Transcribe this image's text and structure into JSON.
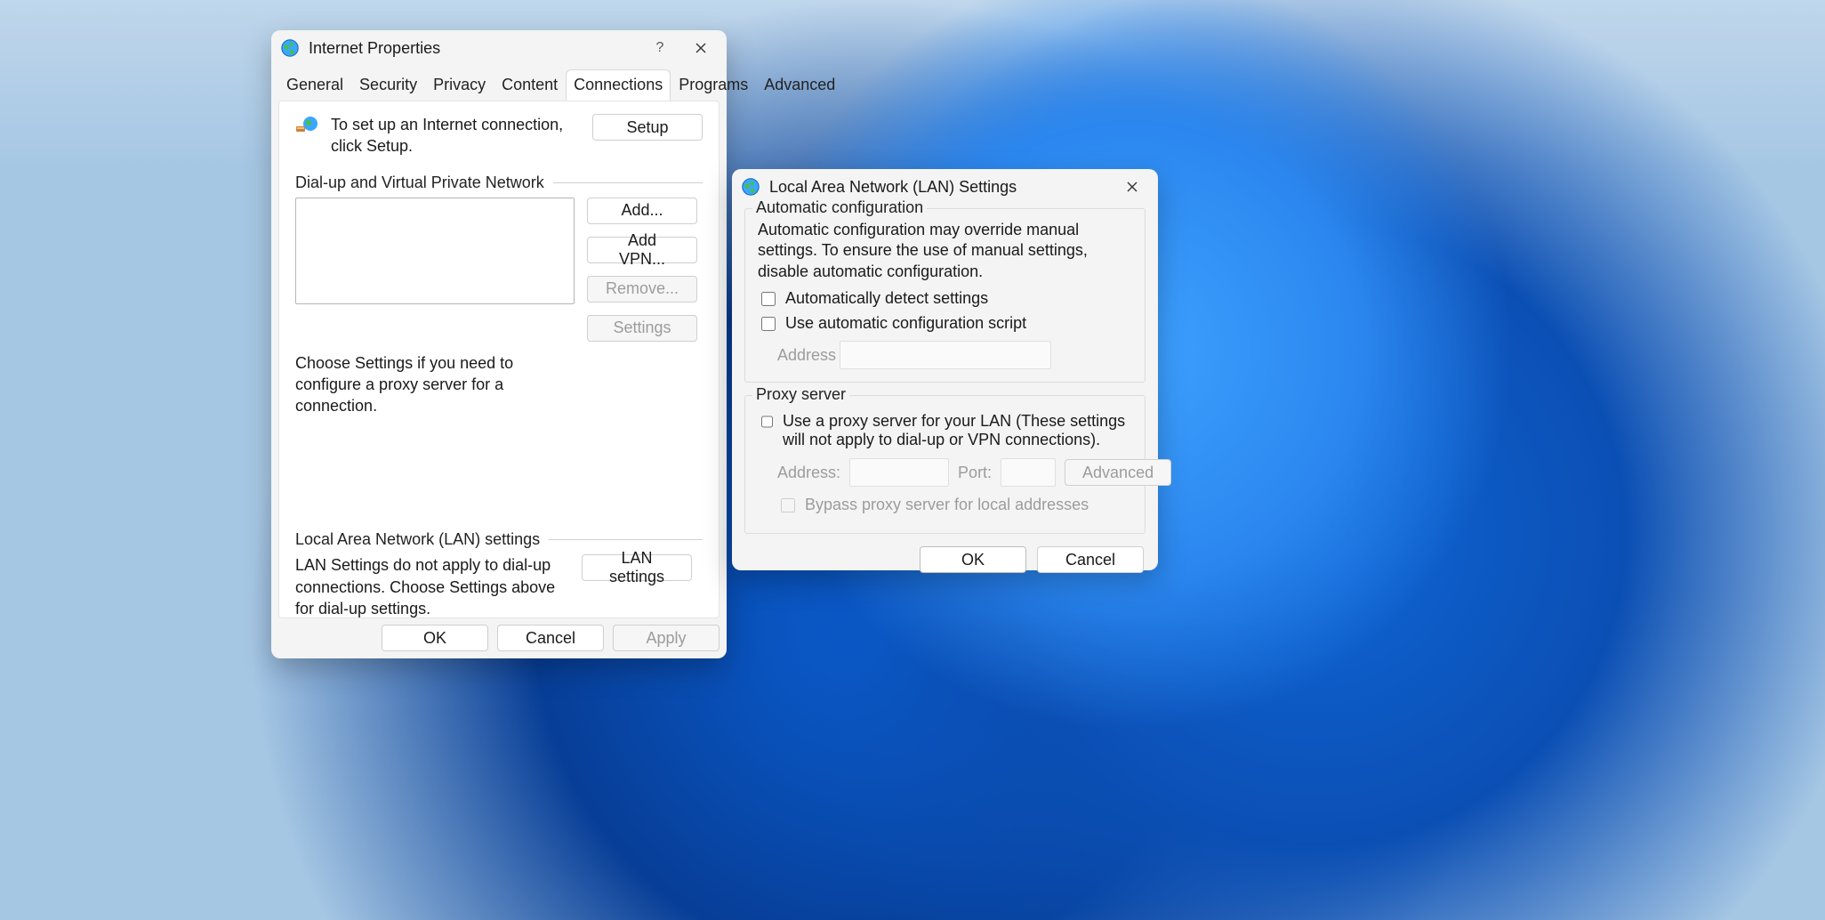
{
  "internet_properties": {
    "title": "Internet Properties",
    "help_tooltip": "?",
    "tabs": {
      "general": "General",
      "security": "Security",
      "privacy": "Privacy",
      "content": "Content",
      "connections": "Connections",
      "programs": "Programs",
      "advanced": "Advanced"
    },
    "active_tab": "connections",
    "setup_text": "To set up an Internet connection, click Setup.",
    "setup_button": "Setup",
    "dialup_group": "Dial-up and Virtual Private Network",
    "add_button": "Add...",
    "add_vpn_button": "Add VPN...",
    "remove_button": "Remove...",
    "settings_button": "Settings",
    "choose_text": "Choose Settings if you need to configure a proxy server for a connection.",
    "lan_group": "Local Area Network (LAN) settings",
    "lan_text": "LAN Settings do not apply to dial-up connections. Choose Settings above for dial-up settings.",
    "lan_settings_button": "LAN settings",
    "ok": "OK",
    "cancel": "Cancel",
    "apply": "Apply"
  },
  "lan_settings": {
    "title": "Local Area Network (LAN) Settings",
    "auto_legend": "Automatic configuration",
    "auto_note": "Automatic configuration may override manual settings.  To ensure the use of manual settings, disable automatic configuration.",
    "auto_detect": "Automatically detect settings",
    "use_script": "Use automatic configuration script",
    "address_label": "Address",
    "proxy_legend": "Proxy server",
    "proxy_note": "Use a proxy server for your LAN (These settings will not apply to dial-up or VPN connections).",
    "addr_label": "Address:",
    "port_label": "Port:",
    "advanced_button": "Advanced",
    "bypass_label": "Bypass proxy server for local addresses",
    "ok": "OK",
    "cancel": "Cancel"
  }
}
